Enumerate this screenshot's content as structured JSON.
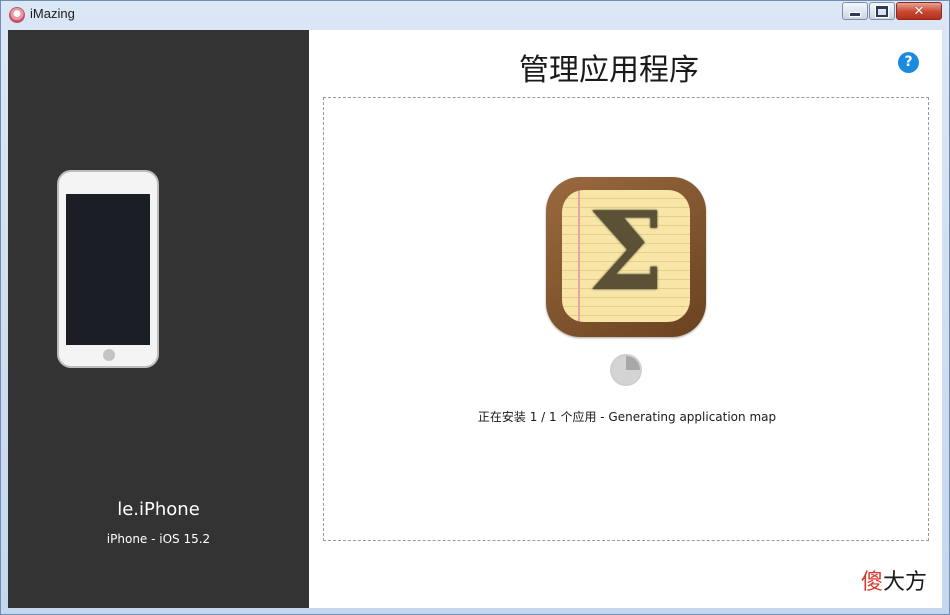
{
  "window": {
    "title": "iMazing",
    "icons": {
      "app": "imazing-app-icon",
      "minimize": "minimize-icon",
      "maximize": "maximize-icon",
      "close": "close-icon"
    }
  },
  "sidebar": {
    "device_name": "le.iPhone",
    "device_info": "iPhone - iOS 15.2",
    "background": "#333333"
  },
  "main": {
    "title": "管理应用程序",
    "help_label": "?",
    "help_color": "#1b8be0",
    "app_icon": "sigma-notebook-app-icon",
    "app_icon_glyph": "Σ",
    "status": "正在安装 1 / 1 个应用 - Generating application map",
    "progress_icon": "pie-progress-spinner"
  },
  "watermark": {
    "part1": "傻",
    "part2": "大方"
  }
}
